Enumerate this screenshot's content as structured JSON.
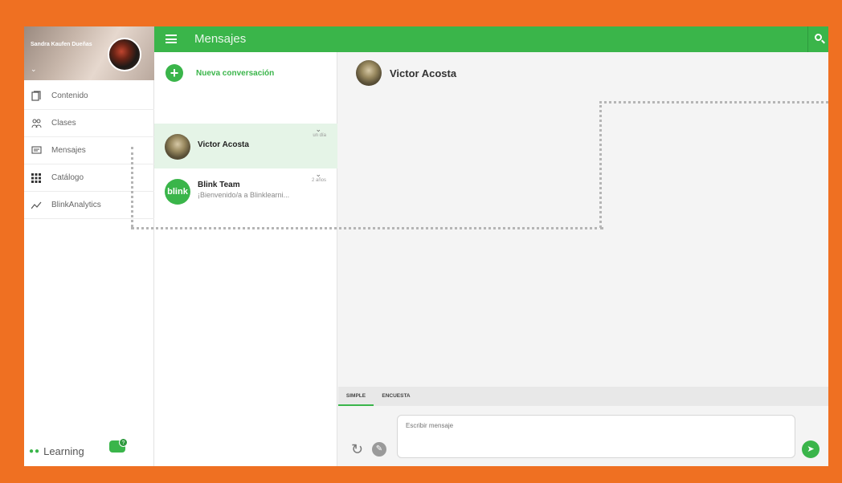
{
  "profile": {
    "name": "Sandra Kaufen Dueñas"
  },
  "topbar": {
    "title": "Mensajes"
  },
  "sidebar": {
    "items": [
      {
        "label": "Contenido",
        "icon": "book-icon"
      },
      {
        "label": "Clases",
        "icon": "users-icon"
      },
      {
        "label": "Mensajes",
        "icon": "message-icon"
      },
      {
        "label": "Catálogo",
        "icon": "grid-icon"
      },
      {
        "label": "BlinkAnalytics",
        "icon": "chart-icon"
      }
    ],
    "logo_text": "Learning"
  },
  "conversations": {
    "new_label": "Nueva conversación",
    "items": [
      {
        "name": "Victor Acosta",
        "preview": "",
        "time": "un día",
        "selected": true
      },
      {
        "name": "Blink Team",
        "preview": "¡Bienvenido/a a Blinklearni...",
        "time": "2 años",
        "avatar_text": "blink",
        "selected": false
      }
    ]
  },
  "chat": {
    "contact_name": "Victor Acosta",
    "tabs": [
      {
        "label": "SIMPLE",
        "active": true
      },
      {
        "label": "ENCUESTA",
        "active": false
      }
    ],
    "input_placeholder": "Escribir mensaje"
  },
  "colors": {
    "accent": "#3ab54a",
    "frame": "#ef7022"
  }
}
